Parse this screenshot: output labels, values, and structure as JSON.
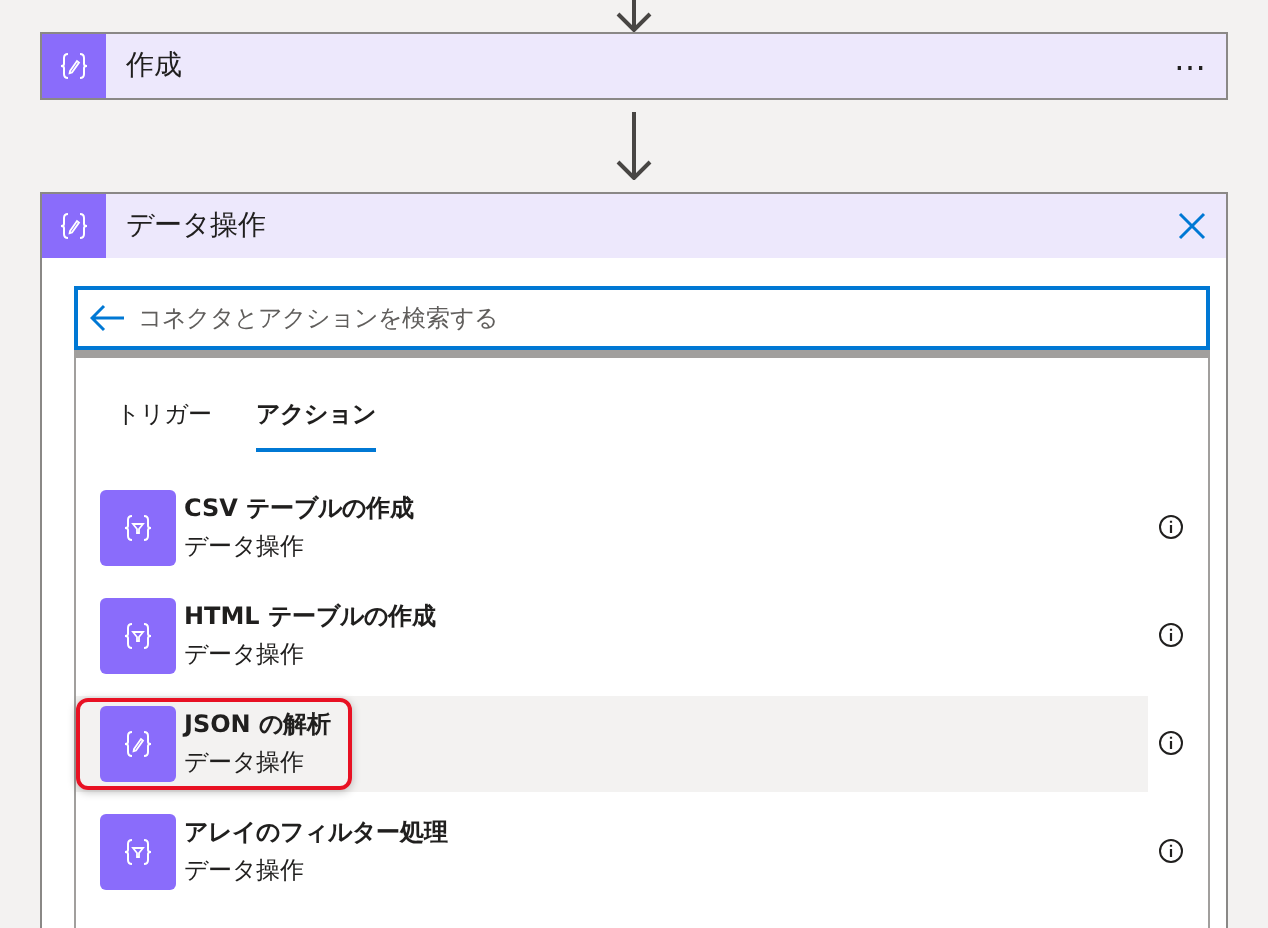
{
  "top_card": {
    "title": "作成",
    "menu": "⋯"
  },
  "panel": {
    "title": "データ操作"
  },
  "search": {
    "placeholder": "コネクタとアクションを検索する"
  },
  "tabs": [
    {
      "label": "トリガー",
      "selected": false
    },
    {
      "label": "アクション",
      "selected": true
    }
  ],
  "actions": [
    {
      "title": "CSV テーブルの作成",
      "subtitle": "データ操作",
      "kind": "filter",
      "selected": false
    },
    {
      "title": "HTML テーブルの作成",
      "subtitle": "データ操作",
      "kind": "filter",
      "selected": false
    },
    {
      "title": "JSON の解析",
      "subtitle": "データ操作",
      "kind": "edit",
      "selected": true
    },
    {
      "title": "アレイのフィルター処理",
      "subtitle": "データ操作",
      "kind": "filter",
      "selected": false
    }
  ]
}
